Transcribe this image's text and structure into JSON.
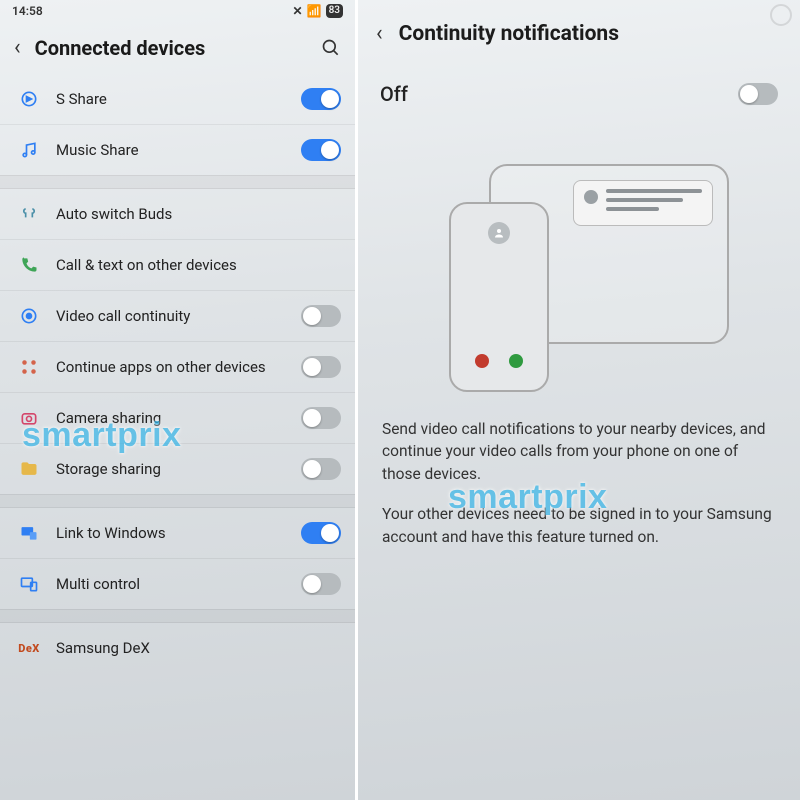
{
  "statusbar": {
    "time": "14:58",
    "battery": "83"
  },
  "left": {
    "title": "Connected devices",
    "items": {
      "sshare": "S Share",
      "music": "Music Share",
      "buds": "Auto switch Buds",
      "calltext": "Call & text on other devices",
      "videocont": "Video call continuity",
      "contapps": "Continue apps on other devices",
      "camshare": "Camera sharing",
      "storshare": "Storage sharing",
      "linkwin": "Link to Windows",
      "multi": "Multi control",
      "dex": "Samsung DeX"
    }
  },
  "right": {
    "title": "Continuity notifications",
    "state": "Off",
    "p1": "Send video call notifications to your nearby devices, and continue your video calls from your phone on one of those devices.",
    "p2": "Your other devices need to be signed in to your Samsung account and have this feature turned on."
  },
  "watermark": "smartprix"
}
